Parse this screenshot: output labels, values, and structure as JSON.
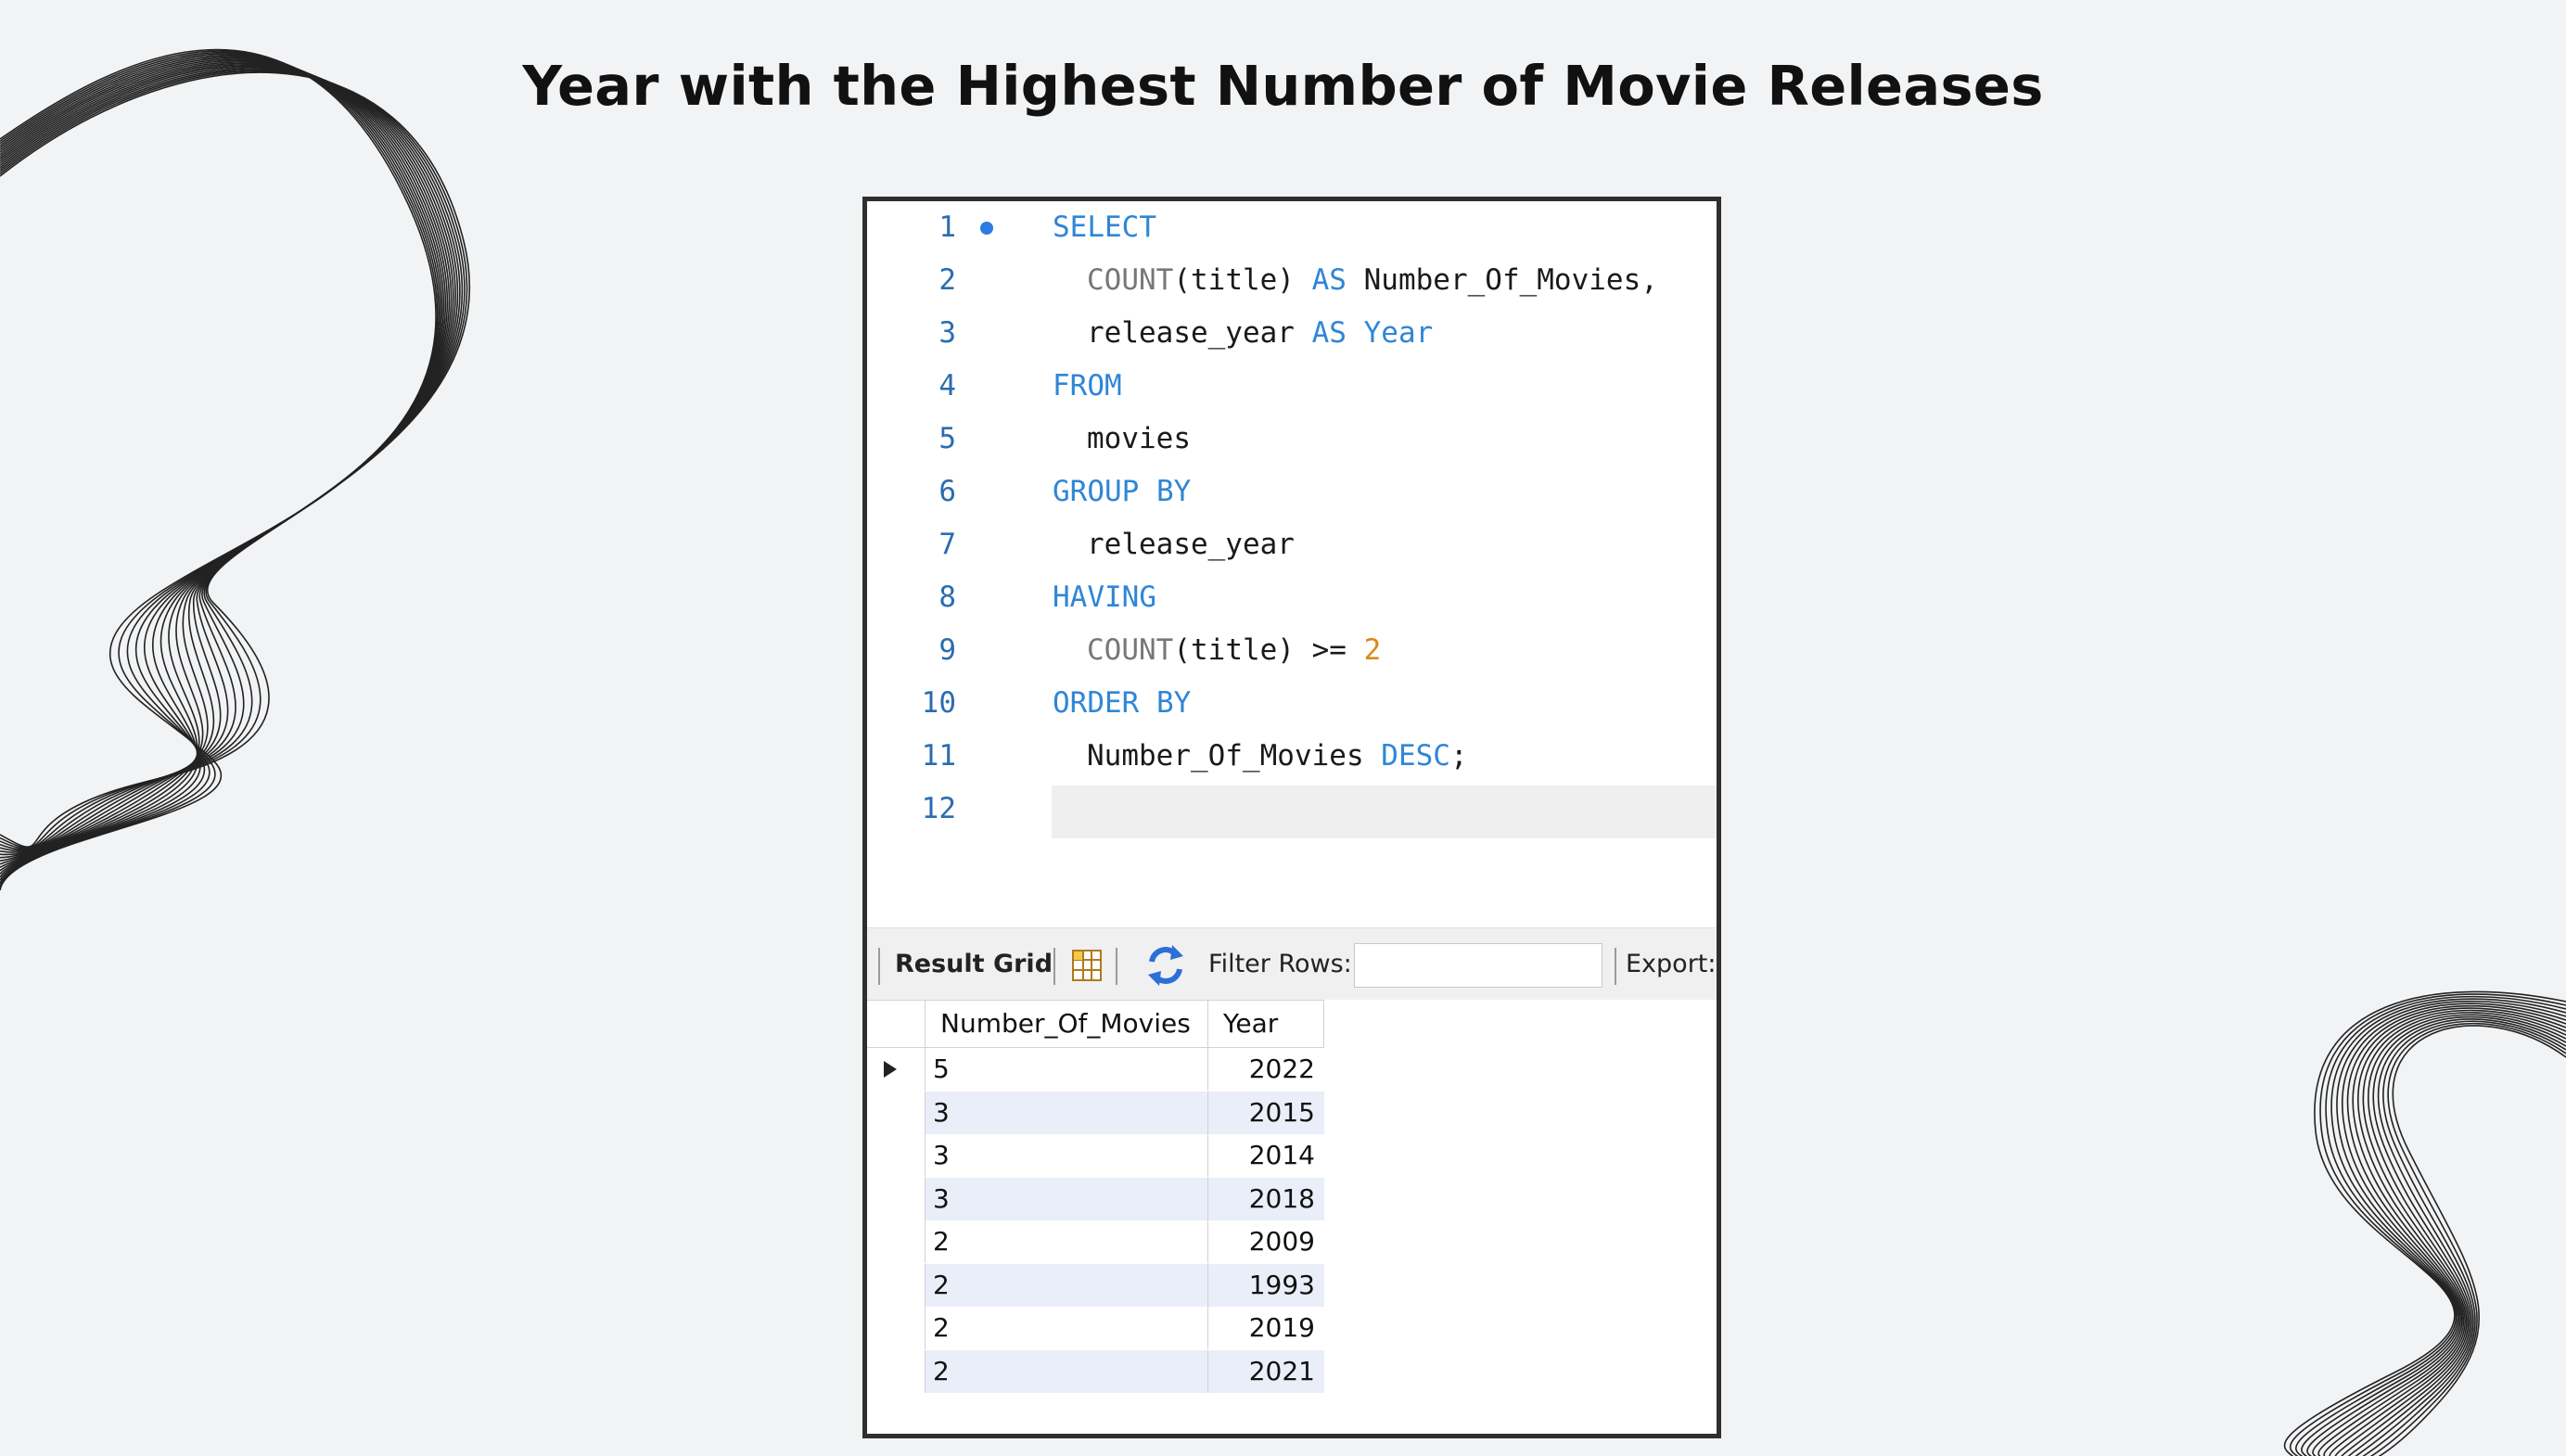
{
  "slide": {
    "title": "Year with the Highest Number of Movie Releases"
  },
  "editor": {
    "lines": [
      {
        "n": "1",
        "parts": [
          {
            "t": "SELECT",
            "c": "kw"
          }
        ]
      },
      {
        "n": "2",
        "parts": [
          {
            "t": "COUNT",
            "c": "fn"
          },
          {
            "t": "(title) ",
            "c": ""
          },
          {
            "t": "AS",
            "c": "kw"
          },
          {
            "t": " Number_Of_Movies,",
            "c": ""
          }
        ]
      },
      {
        "n": "3",
        "parts": [
          {
            "t": "release_year ",
            "c": ""
          },
          {
            "t": "AS",
            "c": "kw"
          },
          {
            "t": " ",
            "c": ""
          },
          {
            "t": "Year",
            "c": "kw"
          }
        ]
      },
      {
        "n": "4",
        "parts": [
          {
            "t": "FROM",
            "c": "kw"
          }
        ]
      },
      {
        "n": "5",
        "parts": [
          {
            "t": "movies",
            "c": ""
          }
        ]
      },
      {
        "n": "6",
        "parts": [
          {
            "t": "GROUP BY",
            "c": "kw"
          }
        ]
      },
      {
        "n": "7",
        "parts": [
          {
            "t": "release_year",
            "c": ""
          }
        ]
      },
      {
        "n": "8",
        "parts": [
          {
            "t": "HAVING",
            "c": "kw"
          }
        ]
      },
      {
        "n": "9",
        "parts": [
          {
            "t": "COUNT",
            "c": "fn"
          },
          {
            "t": "(title) >= ",
            "c": ""
          },
          {
            "t": "2",
            "c": "num"
          }
        ]
      },
      {
        "n": "10",
        "parts": [
          {
            "t": "ORDER BY",
            "c": "kw"
          }
        ]
      },
      {
        "n": "11",
        "parts": [
          {
            "t": "Number_Of_Movies ",
            "c": ""
          },
          {
            "t": "DESC",
            "c": "kw"
          },
          {
            "t": ";",
            "c": ""
          }
        ]
      },
      {
        "n": "12",
        "parts": []
      }
    ],
    "colors": {
      "keyword": "#2f86d6",
      "function": "#777777",
      "number": "#d98a1c",
      "line_number": "#2b6cb0"
    }
  },
  "toolbar": {
    "result_grid_label": "Result Grid",
    "grid_icon": "form-editor-icon",
    "refresh_icon": "refresh-icon",
    "filter_label": "Filter Rows:",
    "filter_value": "",
    "export_label": "Export:"
  },
  "grid": {
    "columns": [
      "Number_Of_Movies",
      "Year"
    ],
    "rows": [
      [
        "5",
        "2022"
      ],
      [
        "3",
        "2015"
      ],
      [
        "3",
        "2014"
      ],
      [
        "3",
        "2018"
      ],
      [
        "2",
        "2009"
      ],
      [
        "2",
        "1993"
      ],
      [
        "2",
        "2019"
      ],
      [
        "2",
        "2021"
      ]
    ],
    "selected_row": 0,
    "stripe_color": "#e9eef9"
  }
}
